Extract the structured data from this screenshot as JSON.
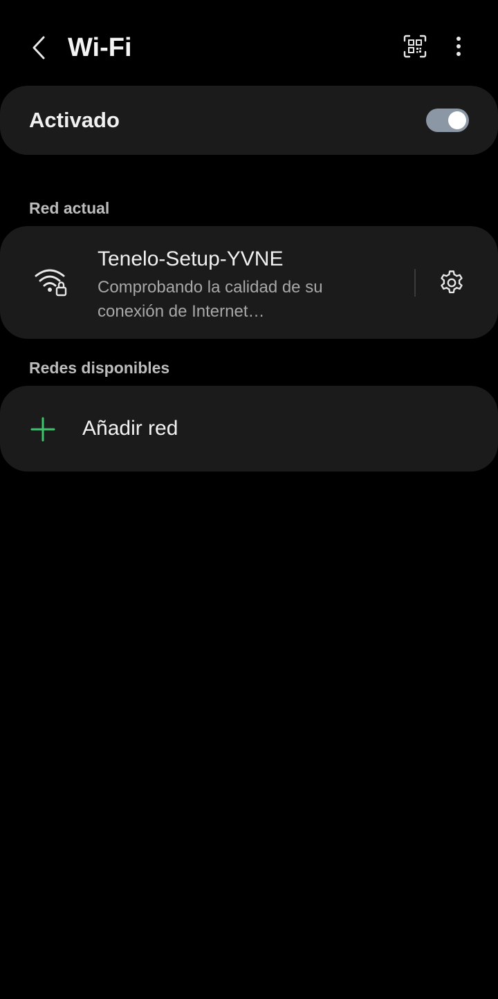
{
  "header": {
    "title": "Wi-Fi",
    "back_icon": "chevron-left-icon",
    "qr_icon": "qr-scan-icon",
    "more_icon": "more-vertical-icon"
  },
  "wifi_toggle": {
    "label": "Activado",
    "checked": true,
    "track_color": "#8b97a5"
  },
  "current_network": {
    "section_label": "Red actual",
    "name": "Tenelo-Setup-YVNE",
    "status": "Comprobando la calidad de su conexión de Internet…",
    "icon": "wifi-lock-icon",
    "settings_icon": "gear-icon"
  },
  "available_networks": {
    "section_label": "Redes disponibles",
    "add_label": "Añadir red",
    "add_icon": "plus-icon",
    "accent_color": "#3ec46d"
  }
}
